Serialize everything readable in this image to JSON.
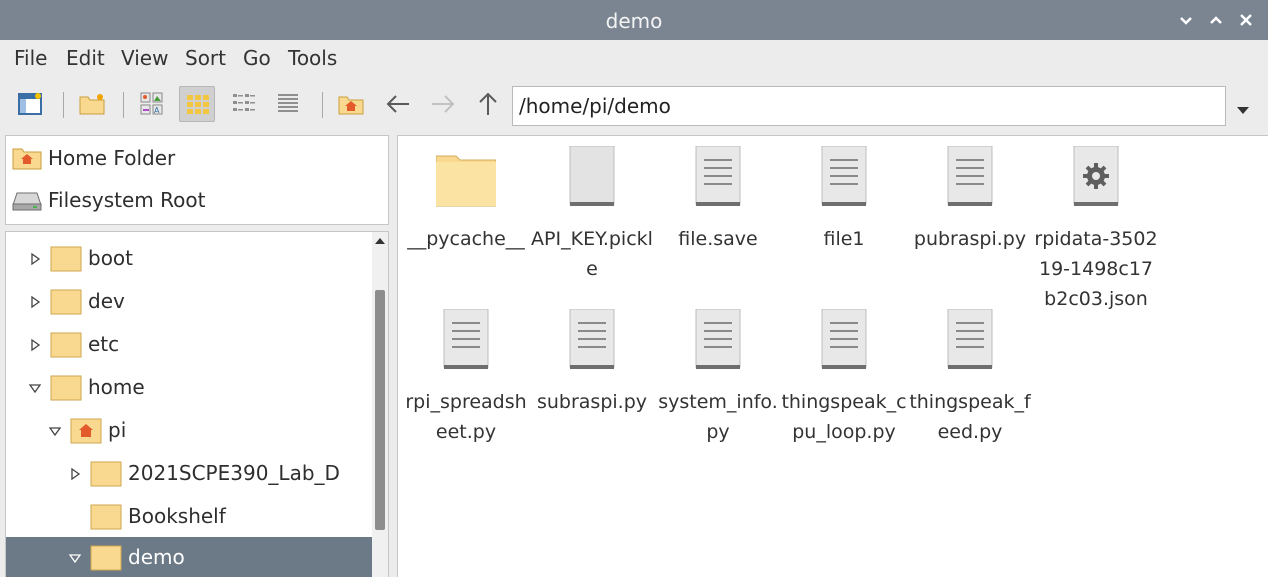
{
  "window": {
    "title": "demo",
    "controls": [
      "minimize-icon",
      "maximize-icon",
      "close-icon"
    ]
  },
  "menubar": {
    "items": [
      "File",
      "Edit",
      "View",
      "Sort",
      "Go",
      "Tools"
    ]
  },
  "toolbar": {
    "buttons": [
      "side-pane-icon",
      "new-folder-icon",
      "icon-view-icon",
      "thumbnail-view-icon",
      "compact-view-icon",
      "list-view-icon",
      "home-icon",
      "back-arrow-icon",
      "forward-arrow-icon",
      "up-arrow-icon"
    ],
    "active": "thumbnail-view-icon",
    "path": "/home/pi/demo"
  },
  "places": [
    {
      "label": "Home Folder",
      "icon": "home-folder-icon"
    },
    {
      "label": "Filesystem Root",
      "icon": "drive-icon"
    }
  ],
  "tree": [
    {
      "label": "boot",
      "depth": 0,
      "expanded": false,
      "has_children": true
    },
    {
      "label": "dev",
      "depth": 0,
      "expanded": false,
      "has_children": true
    },
    {
      "label": "etc",
      "depth": 0,
      "expanded": false,
      "has_children": true
    },
    {
      "label": "home",
      "depth": 0,
      "expanded": true,
      "has_children": true
    },
    {
      "label": "pi",
      "depth": 1,
      "expanded": true,
      "has_children": true,
      "home": true
    },
    {
      "label": "2021SCPE390_Lab_D",
      "depth": 2,
      "expanded": false,
      "has_children": true
    },
    {
      "label": "Bookshelf",
      "depth": 2,
      "expanded": false,
      "has_children": false
    },
    {
      "label": "demo",
      "depth": 2,
      "expanded": true,
      "has_children": true,
      "selected": true
    }
  ],
  "files": [
    {
      "name": "__pycache__",
      "type": "folder"
    },
    {
      "name": "API_KEY.pickle",
      "type": "binary"
    },
    {
      "name": "file.save",
      "type": "text"
    },
    {
      "name": "file1",
      "type": "text"
    },
    {
      "name": "pubraspi.py",
      "type": "text"
    },
    {
      "name": "rpidata-350219-1498c17b2c03.json",
      "type": "config"
    },
    {
      "name": "rpi_spreadsheet.py",
      "type": "text"
    },
    {
      "name": "subraspi.py",
      "type": "text"
    },
    {
      "name": "system_info.py",
      "type": "text"
    },
    {
      "name": "thingspeak_cpu_loop.py",
      "type": "text"
    },
    {
      "name": "thingspeak_feed.py",
      "type": "text"
    }
  ],
  "colors": {
    "titlebar": "#7a8591",
    "selection": "#6b7a86",
    "folder": "#f8d98f",
    "home_accent": "#e35a2b"
  }
}
